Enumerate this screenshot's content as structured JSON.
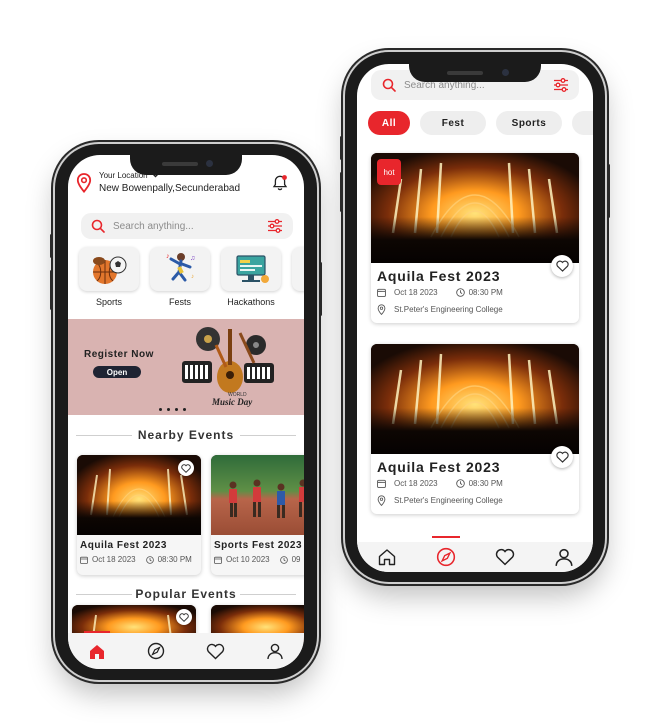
{
  "left_phone": {
    "location_label": "Your Location",
    "location_value": "New Bowenpally,Secunderabad",
    "search_placeholder": "Search anything...",
    "categories": [
      {
        "label": "Sports",
        "icon": "sports-balls-icon"
      },
      {
        "label": "Fests",
        "icon": "dancer-icon"
      },
      {
        "label": "Hackathons",
        "icon": "hackathon-screen-icon"
      }
    ],
    "banner": {
      "heading": "Register Now",
      "button": "Open",
      "art_caption_small": "WORLD",
      "art_caption": "Music Day",
      "page_dots": 4
    },
    "nearby_title": "Nearby Events",
    "nearby_events": [
      {
        "title": "Aquila Fest 2023",
        "date": "Oct 18 2023",
        "time": "08:30 PM"
      },
      {
        "title": "Sports Fest 2023",
        "date": "Oct 10 2023",
        "time": "09"
      }
    ],
    "popular_title": "Popular Events"
  },
  "right_phone": {
    "search_placeholder": "Search anything...",
    "filters": [
      {
        "label": "All",
        "active": true
      },
      {
        "label": "Fest",
        "active": false
      },
      {
        "label": "Sports",
        "active": false
      }
    ],
    "events": [
      {
        "badge": "hot",
        "title": "Aquila Fest 2023",
        "date": "Oct 18 2023",
        "time": "08:30 PM",
        "venue": "St.Peter's Engineering College"
      },
      {
        "badge": "",
        "title": "Aquila Fest 2023",
        "date": "Oct 18 2023",
        "time": "08:30 PM",
        "venue": "St.Peter's Engineering College"
      }
    ]
  },
  "colors": {
    "accent": "#e8262c",
    "banner_bg": "#d9b3b1",
    "nav_bg": "#f4f4f4"
  },
  "nav_icons": [
    "home-icon",
    "compass-icon",
    "heart-icon",
    "profile-icon"
  ]
}
